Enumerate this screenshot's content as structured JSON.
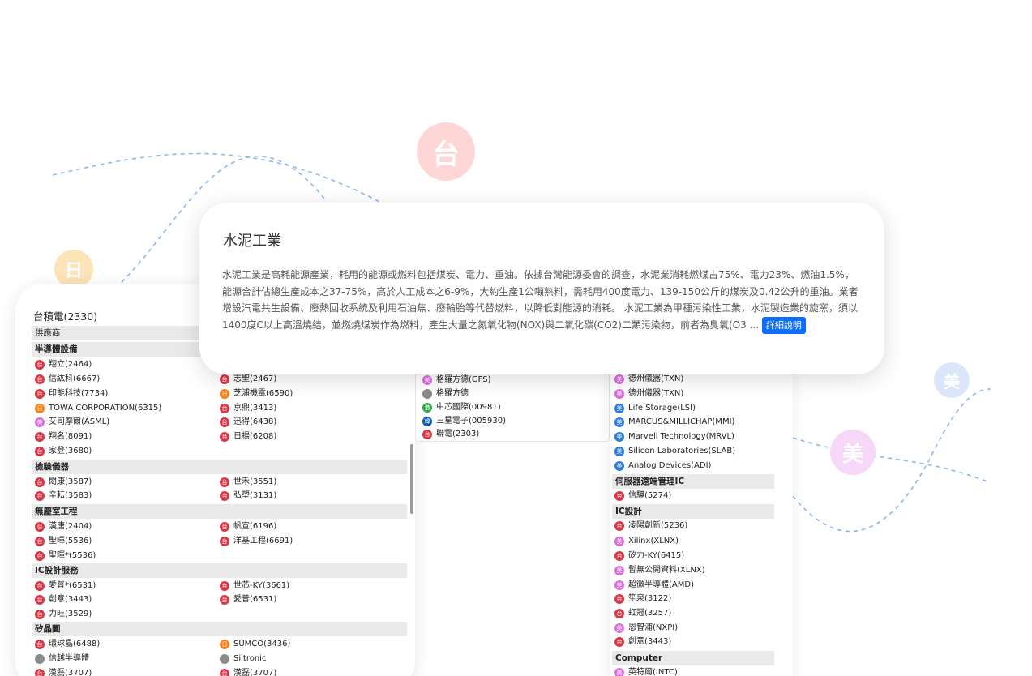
{
  "background": {
    "bubbles": [
      {
        "label": "台",
        "color": "#ffd6d6"
      },
      {
        "label": "日",
        "color": "#fde3b8"
      },
      {
        "label": "美",
        "color": "#f7d7f7"
      },
      {
        "label": "美",
        "color": "#dbe6fb"
      }
    ]
  },
  "colors": {
    "tw": "#dc3545",
    "jp": "#fd7e14",
    "us_pink": "#e069e0",
    "us_blue": "#2a7de1",
    "gray": "#8a8a8a",
    "hk": "#28a745",
    "kr": "#0d5fb3",
    "primary": "#0d6efd"
  },
  "popup": {
    "title": "水泥工業",
    "body": "水泥工業是高耗能源產業，耗用的能源或燃料包括煤炭、電力、重油。依據台灣能源委會的調查，水泥業消耗燃煤占75%、電力23%、燃油1.5%，能源合計佔總生產成本之37-75%，高於人工成本之6-9%，大約生產1公噸熟料，需耗用400度電力、139-150公斤的煤炭及0.42公升的重油。業者增設汽電共生設備、廢熱回收系統及利用石油焦、廢輪胎等代替燃料，以降低對能源的消耗。 水泥工業為甲種污染性工業，水泥製造業的旋窯，須以1400度C以上高溫燒結，並燃燒煤炭作為燃料，產生大量之氮氧化物(NOX)與二氧化碳(CO2)二類污染物，前者為臭氧(O3 ...",
    "detail_button": "詳細說明"
  },
  "left": {
    "title": "台積電(2330)",
    "header": "供應商",
    "sections": [
      {
        "label": "半導體設備"
      },
      {
        "label": "檢驗儀器"
      },
      {
        "label": "無塵室工程"
      },
      {
        "label": "IC設計服務"
      },
      {
        "label": "矽晶圓"
      }
    ],
    "items": [
      {
        "badge": "台",
        "name": "翔立(2464)"
      },
      {
        "badge": "台",
        "name": "信紘科(6667)"
      },
      {
        "badge": "台",
        "name": "志聖(2467)"
      },
      {
        "badge": "台",
        "name": "印能科技(7734)"
      },
      {
        "badge": "日",
        "name": "芝浦機電(6590)"
      },
      {
        "badge": "日",
        "name": "TOWA CORPORATION(6315)"
      },
      {
        "badge": "台",
        "name": "京鼎(3413)"
      },
      {
        "badge": "美",
        "name": "艾司摩爾(ASML)"
      },
      {
        "badge": "台",
        "name": "迅得(6438)"
      },
      {
        "badge": "台",
        "name": "翔名(8091)"
      },
      {
        "badge": "台",
        "name": "日揚(6208)"
      },
      {
        "badge": "台",
        "name": "家登(3680)"
      },
      {
        "badge": "台",
        "name": "閎康(3587)"
      },
      {
        "badge": "台",
        "name": "世禾(3551)"
      },
      {
        "badge": "台",
        "name": "辛耘(3583)"
      },
      {
        "badge": "台",
        "name": "弘塑(3131)"
      },
      {
        "badge": "台",
        "name": "漢唐(2404)"
      },
      {
        "badge": "台",
        "name": "帆宣(6196)"
      },
      {
        "badge": "台",
        "name": "聖暉(5536)"
      },
      {
        "badge": "台",
        "name": "洋基工程(6691)"
      },
      {
        "badge": "台",
        "name": "聖暉*(5536)"
      },
      {
        "badge": "台",
        "name": "愛普*(6531)"
      },
      {
        "badge": "台",
        "name": "世芯-KY(3661)"
      },
      {
        "badge": "台",
        "name": "創意(3443)"
      },
      {
        "badge": "台",
        "name": "愛普(6531)"
      },
      {
        "badge": "台",
        "name": "力旺(3529)"
      },
      {
        "badge": "台",
        "name": "環球晶(6488)"
      },
      {
        "badge": "日",
        "name": "SUMCO(3436)"
      },
      {
        "badge": "",
        "name": "信越半導體"
      },
      {
        "badge": "",
        "name": "Siltronic"
      },
      {
        "badge": "台",
        "name": "漢磊(3707)"
      },
      {
        "badge": "台",
        "name": "漢磊(3707)"
      }
    ]
  },
  "middle": {
    "items": [
      {
        "badge": "美",
        "name": "格羅方德(GFS)"
      },
      {
        "badge": "",
        "name": "格羅方德"
      },
      {
        "badge": "港",
        "name": "中芯國際(00981)"
      },
      {
        "badge": "韓",
        "name": "三星電子(005930)"
      },
      {
        "badge": "台",
        "name": "聯電(2303)"
      }
    ]
  },
  "right": {
    "sections": [
      {
        "label": "伺服器遠端管理IC"
      },
      {
        "label": "IC設計"
      },
      {
        "label": "Computer"
      }
    ],
    "items": [
      {
        "badge": "美",
        "name": "德州儀器(TXN)"
      },
      {
        "badge": "美",
        "name": "德州儀器(TXN)"
      },
      {
        "badge": "美",
        "name": "Life Storage(LSI)"
      },
      {
        "badge": "美",
        "name": "MARCUS&MILLICHAP(MMI)"
      },
      {
        "badge": "美",
        "name": "Marvell Technology(MRVL)"
      },
      {
        "badge": "美",
        "name": "Silicon Laboratories(SLAB)"
      },
      {
        "badge": "美",
        "name": "Analog Devices(ADI)"
      },
      {
        "badge": "台",
        "name": "信驊(5274)"
      },
      {
        "badge": "台",
        "name": "凌陽創新(5236)"
      },
      {
        "badge": "美",
        "name": "Xilinx(XLNX)"
      },
      {
        "badge": "台",
        "name": "矽力-KY(6415)"
      },
      {
        "badge": "美",
        "name": "暫無公開資料(XLNX)"
      },
      {
        "badge": "美",
        "name": "超微半導體(AMD)"
      },
      {
        "badge": "台",
        "name": "笙泉(3122)"
      },
      {
        "badge": "台",
        "name": "虹冠(3257)"
      },
      {
        "badge": "美",
        "name": "恩智浦(NXPI)"
      },
      {
        "badge": "台",
        "name": "創意(3443)"
      },
      {
        "badge": "美",
        "name": "英特爾(INTC)"
      }
    ]
  }
}
